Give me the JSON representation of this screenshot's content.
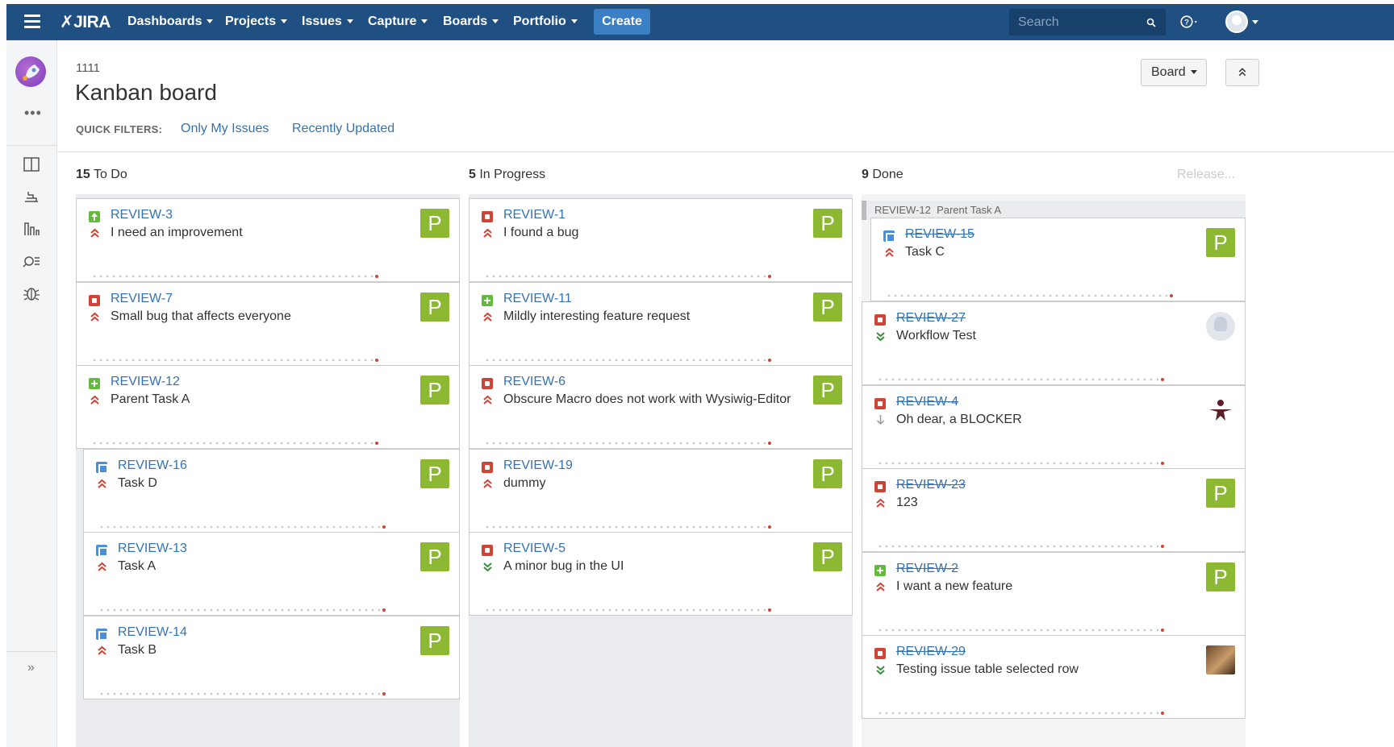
{
  "nav": {
    "logo": "JIRA",
    "items": [
      "Dashboards",
      "Projects",
      "Issues",
      "Capture",
      "Boards",
      "Portfolio"
    ],
    "create": "Create",
    "search_placeholder": "Search"
  },
  "header": {
    "project_key": "1111",
    "title": "Kanban board",
    "quick_filters_label": "QUICK FILTERS:",
    "quick_filters": [
      "Only My Issues",
      "Recently Updated"
    ],
    "board_button": "Board"
  },
  "columns": [
    {
      "count": "15",
      "name": "To Do"
    },
    {
      "count": "5",
      "name": "In Progress"
    },
    {
      "count": "9",
      "name": "Done",
      "release": "Release..."
    }
  ],
  "todo": [
    {
      "key": "REVIEW-3",
      "type": "story",
      "priority": "highest",
      "summary": "I need an improvement",
      "assignee": "P"
    },
    {
      "key": "REVIEW-7",
      "type": "bug",
      "priority": "highest",
      "summary": "Small bug that affects everyone",
      "assignee": "P"
    },
    {
      "key": "REVIEW-12",
      "type": "new-feature",
      "priority": "highest",
      "summary": "Parent Task A",
      "assignee": "P"
    },
    {
      "key": "REVIEW-16",
      "type": "subtask",
      "priority": "highest",
      "summary": "Task D",
      "assignee": "P"
    },
    {
      "key": "REVIEW-13",
      "type": "subtask",
      "priority": "highest",
      "summary": "Task A",
      "assignee": "P"
    },
    {
      "key": "REVIEW-14",
      "type": "subtask",
      "priority": "highest",
      "summary": "Task B",
      "assignee": "P"
    }
  ],
  "inprogress": [
    {
      "key": "REVIEW-1",
      "type": "bug",
      "priority": "highest",
      "summary": "I found a bug",
      "assignee": "P"
    },
    {
      "key": "REVIEW-11",
      "type": "new-feature",
      "priority": "highest",
      "summary": "Mildly interesting feature request",
      "assignee": "P"
    },
    {
      "key": "REVIEW-6",
      "type": "bug",
      "priority": "highest",
      "summary": "Obscure Macro does not work with Wysiwig-Editor",
      "assignee": "P"
    },
    {
      "key": "REVIEW-19",
      "type": "bug",
      "priority": "highest",
      "summary": "dummy",
      "assignee": "P"
    },
    {
      "key": "REVIEW-5",
      "type": "bug",
      "priority": "lowest",
      "summary": "A minor bug in the UI",
      "assignee": "P"
    }
  ],
  "done": {
    "parent_key": "REVIEW-12",
    "parent_summary": "Parent Task A",
    "cards": [
      {
        "key": "REVIEW-15",
        "type": "subtask",
        "priority": "highest",
        "summary": "Task C",
        "assignee": "P"
      },
      {
        "key": "REVIEW-27",
        "type": "bug",
        "priority": "lowest",
        "summary": "Workflow Test",
        "assignee": ""
      },
      {
        "key": "REVIEW-4",
        "type": "bug",
        "priority": "low",
        "summary": "Oh dear, a BLOCKER",
        "assignee": ""
      },
      {
        "key": "REVIEW-23",
        "type": "bug",
        "priority": "highest",
        "summary": "123",
        "assignee": "P"
      },
      {
        "key": "REVIEW-2",
        "type": "new-feature",
        "priority": "highest",
        "summary": "I want a new feature",
        "assignee": "P"
      },
      {
        "key": "REVIEW-29",
        "type": "bug",
        "priority": "lowest",
        "summary": "Testing issue table selected row",
        "assignee": ""
      }
    ]
  },
  "colors": {
    "nav": "#205081",
    "link": "#3572b0",
    "assignee": "#8db832",
    "bug": "#d04437",
    "story": "#63ba3c",
    "task": "#4a90d9"
  }
}
